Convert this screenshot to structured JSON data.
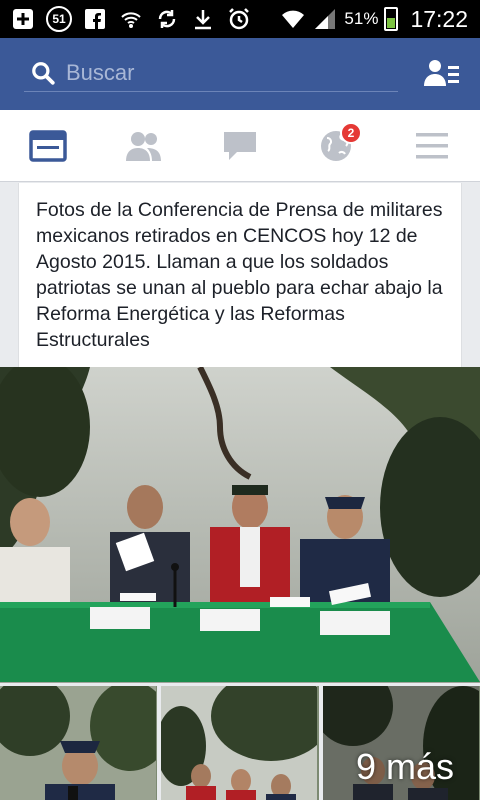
{
  "status_bar": {
    "notification_count": "51",
    "battery_percent": "51%",
    "battery_level": 0.51,
    "time": "17:22",
    "icons": [
      "add-box-icon",
      "facebook-icon",
      "wifi-router-icon",
      "sync-icon",
      "download-icon",
      "alarm-icon",
      "wifi-icon",
      "signal-icon",
      "battery-icon"
    ]
  },
  "header": {
    "search_placeholder": "Buscar",
    "background": "#3b5998"
  },
  "tabs": {
    "items": [
      "news-feed-tab",
      "friend-requests-tab",
      "messages-tab",
      "notifications-tab",
      "more-menu-tab"
    ],
    "notifications_badge": "2",
    "active_color": "#3b5998",
    "inactive_color": "#bdc1c9"
  },
  "post": {
    "text": "Fotos de la Conferencia de Prensa de militares mexicanos retirados en CENCOS hoy 12 de Agosto 2015. Llaman a que los soldados patriotas se unan al pueblo para echar abajo la Reforma Energética y las Reformas Estructurales",
    "more_photos_label": "9 más"
  }
}
